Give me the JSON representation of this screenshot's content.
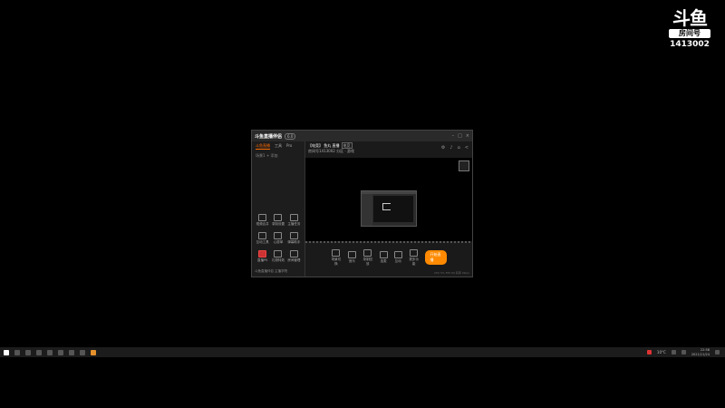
{
  "overlay": {
    "logo_glyph": "斗鱼",
    "logo_sub": "房间号",
    "room_number": "1413002"
  },
  "window": {
    "brand": "斗鱼直播伴侣",
    "version": "6.0",
    "left_tabs": [
      "斗鱼直播",
      "工具",
      "Pro"
    ],
    "scene_label": "场景1",
    "add_label": "+ 添加",
    "tools": [
      {
        "name": "tool-1",
        "label": "视频合并"
      },
      {
        "name": "tool-2",
        "label": "录制设置"
      },
      {
        "name": "tool-3",
        "label": "主播任务"
      },
      {
        "name": "tool-4",
        "label": "互动工具"
      },
      {
        "name": "tool-5",
        "label": "心愿单"
      },
      {
        "name": "tool-6",
        "label": "弹幕助手"
      },
      {
        "name": "tool-7",
        "label": "直播PK"
      },
      {
        "name": "tool-8",
        "label": "礼物特效"
      },
      {
        "name": "tool-9",
        "label": "房间管理"
      }
    ],
    "left_footer": "斗鱼直播伴侣 主播学院",
    "room_title": "【电竞】 鱼丸 直播",
    "room_tag": "电竞",
    "room_sub": "房间号1413002  分区 · 游戏",
    "controls": [
      {
        "name": "ctrl-scene",
        "label": "场景切换"
      },
      {
        "name": "ctrl-music",
        "label": "音乐"
      },
      {
        "name": "ctrl-record",
        "label": "录制回放"
      },
      {
        "name": "ctrl-pk",
        "label": "连麦"
      },
      {
        "name": "ctrl-live",
        "label": "互动"
      },
      {
        "name": "ctrl-more",
        "label": "更多功能"
      }
    ],
    "start_live": "开始直播",
    "status_text": "CPU 5%  FPS 60  码率 0kb/s"
  },
  "taskbar": {
    "time": "22:58",
    "date": "2021/11/24",
    "weather": "10°C"
  }
}
